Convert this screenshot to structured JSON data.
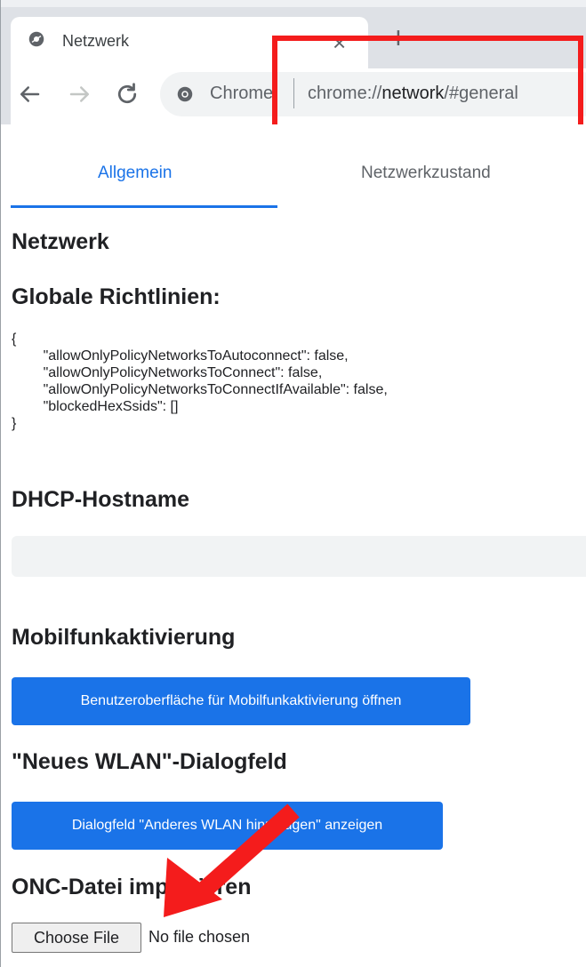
{
  "browser": {
    "tab": {
      "title": "Netzwerk",
      "close_glyph": "×",
      "favicon": "settings-gear-icon"
    },
    "new_tab_glyph": "+",
    "toolbar": {
      "back_icon": "arrow-left-icon",
      "forward_icon": "arrow-right-icon",
      "reload_icon": "reload-icon",
      "site_label": "Chrome",
      "url_prefix": "chrome://",
      "url_host": "network",
      "url_suffix": "/#general"
    },
    "colors": {
      "frame": "#dee1e6",
      "accent": "#1a73e8",
      "annotation": "#f41c1c"
    }
  },
  "page": {
    "tabs": [
      {
        "label": "Allgemein",
        "active": true
      },
      {
        "label": "Netzwerkzustand",
        "active": false
      }
    ],
    "sections": {
      "network_heading": "Netzwerk",
      "global_policies_heading": "Globale Richtlinien:",
      "global_policies_json": "{\n        \"allowOnlyPolicyNetworksToAutoconnect\": false,\n        \"allowOnlyPolicyNetworksToConnect\": false,\n        \"allowOnlyPolicyNetworksToConnectIfAvailable\": false,\n        \"blockedHexSsids\": []\n}",
      "dhcp_heading": "DHCP-Hostname",
      "dhcp_value": "",
      "mobile_heading": "Mobilfunkaktivierung",
      "mobile_button": "Benutzeroberfläche für Mobilfunkaktivierung öffnen",
      "wlan_heading": "\"Neues WLAN\"-Dialogfeld",
      "wlan_button": "Dialogfeld \"Anderes WLAN hinzufügen\" anzeigen",
      "onc_heading": "ONC-Datei importieren",
      "file_button": "Choose File",
      "file_status": "No file chosen"
    }
  }
}
